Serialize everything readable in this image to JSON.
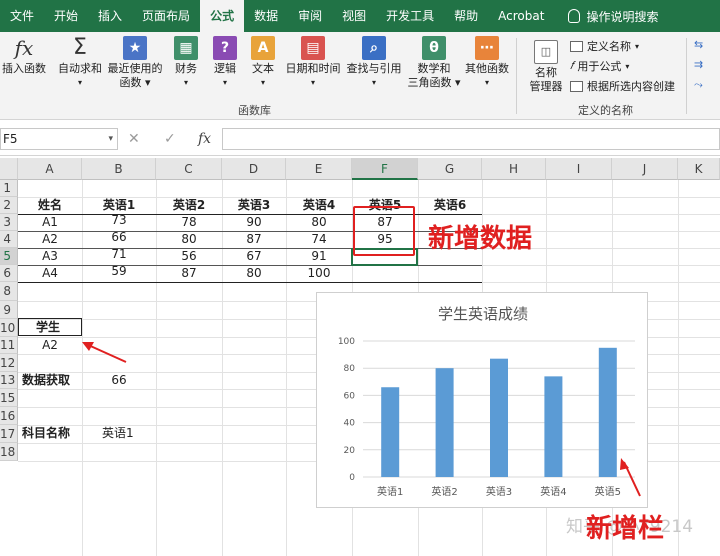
{
  "ribbon_tabs": [
    "文件",
    "开始",
    "插入",
    "页面布局",
    "公式",
    "数据",
    "审阅",
    "视图",
    "开发工具",
    "帮助",
    "Acrobat"
  ],
  "active_tab": "公式",
  "tell_me": "操作说明搜索",
  "ribbon": {
    "insert_function": "插入函数",
    "autosum": "自动求和",
    "recently_used": [
      "最近使用的",
      "函数"
    ],
    "financial": "财务",
    "logical": "逻辑",
    "text": "文本",
    "datetime": "日期和时间",
    "lookup": "查找与引用",
    "math": [
      "数学和",
      "三角函数"
    ],
    "more": "其他函数",
    "group_function_library": "函数库",
    "name_manager": [
      "名称",
      "管理器"
    ],
    "define_name": "定义名称",
    "use_in_formula": "用于公式",
    "create_from_selection": "根据所选内容创建",
    "group_defined_names": "定义的名称"
  },
  "formula_bar": {
    "name_box": "F5",
    "fx": "fx",
    "cancel": "✕",
    "enter": "✓",
    "content": ""
  },
  "columns": [
    "A",
    "B",
    "C",
    "D",
    "E",
    "F",
    "G",
    "H",
    "I",
    "J",
    "K"
  ],
  "rows": [
    "1",
    "2",
    "3",
    "4",
    "5",
    "6",
    "8",
    "9",
    "10",
    "11",
    "12",
    "13",
    "15",
    "16",
    "17",
    "18"
  ],
  "table": {
    "headers": [
      "姓名",
      "英语1",
      "英语2",
      "英语3",
      "英语4",
      "英语5",
      "英语6"
    ],
    "data": [
      [
        "A1",
        "73",
        "78",
        "90",
        "80",
        "87"
      ],
      [
        "A2",
        "66",
        "80",
        "87",
        "74",
        "95"
      ],
      [
        "A3",
        "71",
        "56",
        "67",
        "91",
        ""
      ],
      [
        "A4",
        "59",
        "87",
        "80",
        "100",
        ""
      ]
    ]
  },
  "lookup": {
    "student_label": "学生",
    "student_value": "A2",
    "fetch_label": "数据获取",
    "fetch_value": "66",
    "subject_label": "科目名称",
    "subject_value": "英语1"
  },
  "annotations": {
    "new_data": "新增数据",
    "new_column": "新增栏"
  },
  "watermark": "知乎 @小Y9214",
  "colors": {
    "excel_green": "#217346",
    "bar_blue": "#5b9bd5",
    "annotation_red": "#e02020"
  },
  "chart_data": {
    "type": "bar",
    "title": "学生英语成绩",
    "categories": [
      "英语1",
      "英语2",
      "英语3",
      "英语4",
      "英语5"
    ],
    "values": [
      66,
      80,
      87,
      74,
      95
    ],
    "ylim": [
      0,
      100
    ],
    "yticks": [
      0,
      20,
      40,
      60,
      80,
      100
    ],
    "grid": true,
    "legend": "none"
  }
}
